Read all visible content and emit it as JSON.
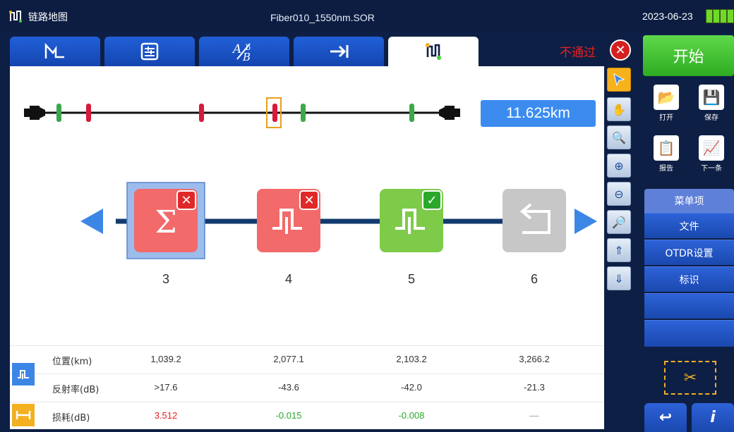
{
  "topbar": {
    "title": "链路地图",
    "file_name": "Fiber010_1550nm.SOR",
    "date": "2023-06-23"
  },
  "tabs": [
    {
      "icon": "trace-icon",
      "glyph": "⊓"
    },
    {
      "icon": "table-icon",
      "glyph": "▤"
    },
    {
      "icon": "ab-compare-icon",
      "glyph": "A/B"
    },
    {
      "icon": "arrow-right-bar-icon",
      "glyph": "→|"
    },
    {
      "icon": "link-map-icon",
      "glyph": "⎍",
      "active": true
    }
  ],
  "status": {
    "label": "不通过",
    "icon": "fail-x-icon",
    "color": "#e82020"
  },
  "distance": "11.625km",
  "events": [
    {
      "num": "3",
      "type": "sum",
      "status": "fail"
    },
    {
      "num": "4",
      "type": "reflective",
      "status": "fail"
    },
    {
      "num": "5",
      "type": "reflective",
      "status": "pass"
    },
    {
      "num": "6",
      "type": "end",
      "status": "none"
    }
  ],
  "table": {
    "rows": [
      {
        "label": "位置(km)",
        "values": [
          "1,039.2",
          "2,077.1",
          "2,103.2",
          "3,266.2"
        ]
      },
      {
        "label": "反射率(dB)",
        "values": [
          ">17.6",
          "-43.6",
          "-42.0",
          "-21.3"
        ]
      },
      {
        "label": "损耗(dB)",
        "values": [
          "3.512",
          "-0.015",
          "-0.008",
          "—"
        ]
      }
    ]
  },
  "right": {
    "start": "开始",
    "open": "打开",
    "save": "保存",
    "report": "报告",
    "next": "下一条",
    "menu_head": "菜单项",
    "menu": [
      "文件",
      "OTDR设置",
      "标识",
      "",
      ""
    ]
  },
  "colors": {
    "fail": "#e82020",
    "pass": "#2aa82a",
    "accent": "#3c8cf0"
  }
}
